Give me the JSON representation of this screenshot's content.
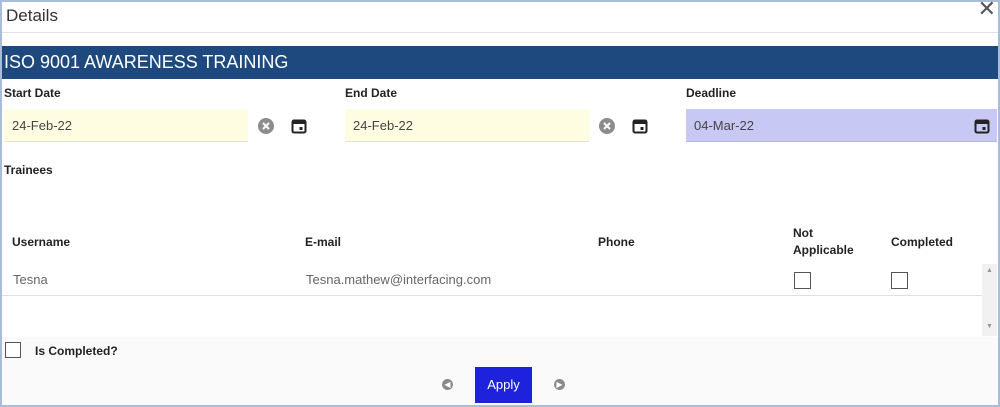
{
  "dialog": {
    "title": "Details",
    "close_icon": "close-icon"
  },
  "banner": {
    "title": "ISO 9001 AWARENESS TRAINING"
  },
  "dates": {
    "start": {
      "label": "Start Date",
      "value": "24-Feb-22"
    },
    "end": {
      "label": "End Date",
      "value": "24-Feb-22"
    },
    "deadline": {
      "label": "Deadline",
      "value": "04-Mar-22"
    }
  },
  "trainees": {
    "label": "Trainees",
    "columns": {
      "username": "Username",
      "email": "E-mail",
      "phone": "Phone",
      "not_applicable": "Not Applicable",
      "completed": "Completed"
    },
    "rows": [
      {
        "username": "Tesna",
        "email": "Tesna.mathew@interfacing.com",
        "phone": "",
        "not_applicable": false,
        "completed": false
      }
    ]
  },
  "footer": {
    "is_completed_label": "Is Completed?",
    "apply_label": "Apply"
  },
  "colors": {
    "banner": "#1d497e",
    "apply": "#1e22dc",
    "date_field": "#fefde2",
    "deadline_field": "#c8c8f4"
  }
}
